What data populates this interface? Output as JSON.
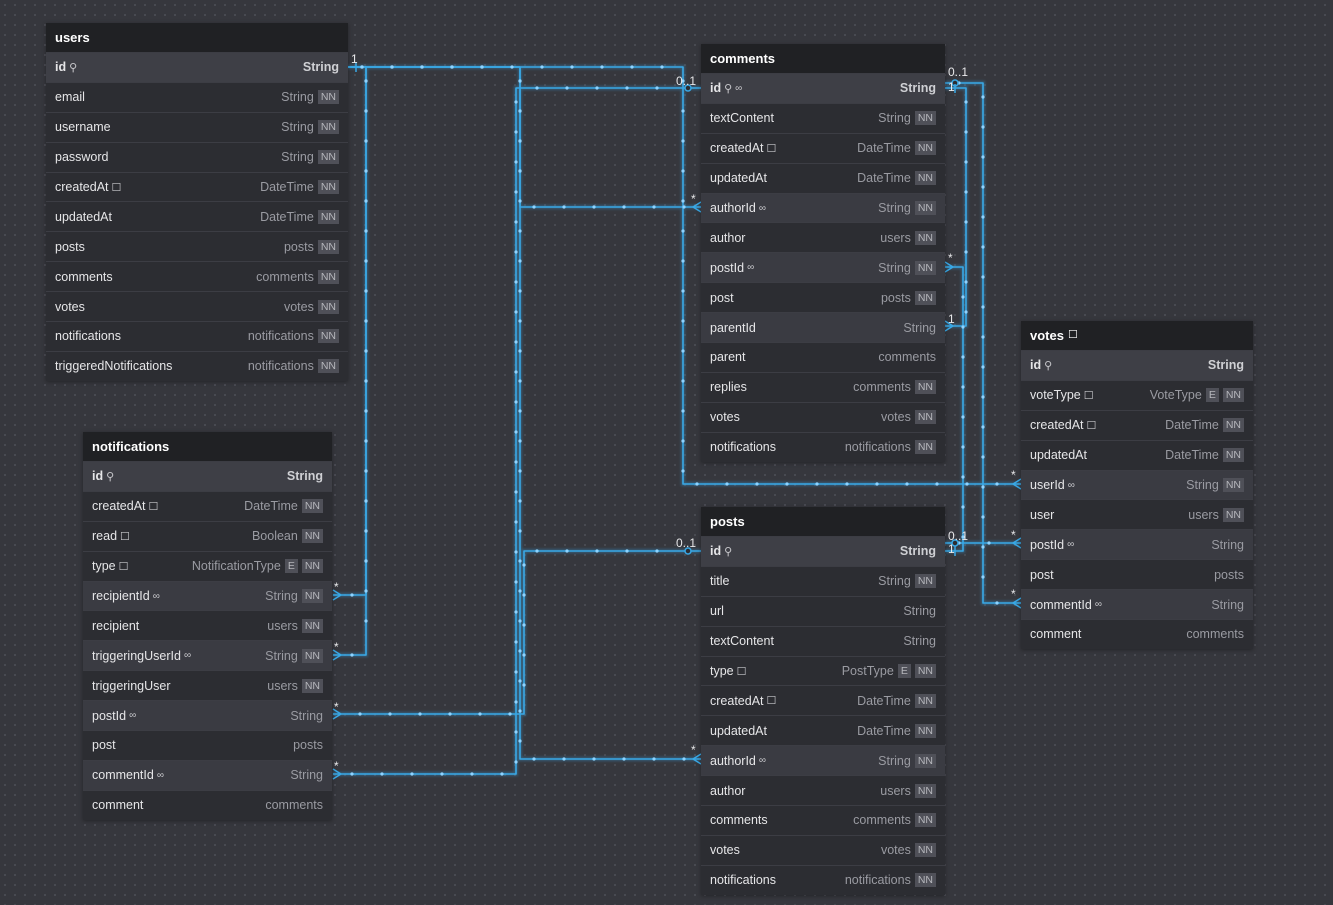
{
  "tables": [
    {
      "id": "users",
      "name": "users",
      "note": false,
      "fields": [
        {
          "name": "id",
          "type": "String",
          "pk": true,
          "icons": [
            "key"
          ]
        },
        {
          "name": "email",
          "type": "String",
          "nn": true
        },
        {
          "name": "username",
          "type": "String",
          "nn": true
        },
        {
          "name": "password",
          "type": "String",
          "nn": true
        },
        {
          "name": "createdAt",
          "type": "DateTime",
          "nn": true,
          "icons": [
            "note"
          ]
        },
        {
          "name": "updatedAt",
          "type": "DateTime",
          "nn": true
        },
        {
          "name": "posts",
          "type": "posts",
          "nn": true
        },
        {
          "name": "comments",
          "type": "comments",
          "nn": true
        },
        {
          "name": "votes",
          "type": "votes",
          "nn": true
        },
        {
          "name": "notifications",
          "type": "notifications",
          "nn": true
        },
        {
          "name": "triggeredNotifications",
          "type": "notifications",
          "nn": true
        }
      ]
    },
    {
      "id": "notifications",
      "name": "notifications",
      "note": false,
      "fields": [
        {
          "name": "id",
          "type": "String",
          "pk": true,
          "icons": [
            "key"
          ]
        },
        {
          "name": "createdAt",
          "type": "DateTime",
          "nn": true,
          "icons": [
            "note"
          ]
        },
        {
          "name": "read",
          "type": "Boolean",
          "nn": true,
          "icons": [
            "note"
          ]
        },
        {
          "name": "type",
          "type": "NotificationType",
          "enum": true,
          "nn": true,
          "icons": [
            "note"
          ]
        },
        {
          "name": "recipientId",
          "type": "String",
          "nn": true,
          "fk": true,
          "icons": [
            "link"
          ]
        },
        {
          "name": "recipient",
          "type": "users",
          "nn": true
        },
        {
          "name": "triggeringUserId",
          "type": "String",
          "nn": true,
          "fk": true,
          "icons": [
            "link"
          ]
        },
        {
          "name": "triggeringUser",
          "type": "users",
          "nn": true
        },
        {
          "name": "postId",
          "type": "String",
          "fk": true,
          "icons": [
            "link"
          ]
        },
        {
          "name": "post",
          "type": "posts"
        },
        {
          "name": "commentId",
          "type": "String",
          "fk": true,
          "icons": [
            "link"
          ]
        },
        {
          "name": "comment",
          "type": "comments"
        }
      ]
    },
    {
      "id": "comments",
      "name": "comments",
      "note": false,
      "fields": [
        {
          "name": "id",
          "type": "String",
          "pk": true,
          "icons": [
            "key",
            "link"
          ]
        },
        {
          "name": "textContent",
          "type": "String",
          "nn": true
        },
        {
          "name": "createdAt",
          "type": "DateTime",
          "nn": true,
          "icons": [
            "note"
          ]
        },
        {
          "name": "updatedAt",
          "type": "DateTime",
          "nn": true
        },
        {
          "name": "authorId",
          "type": "String",
          "nn": true,
          "fk": true,
          "icons": [
            "link"
          ]
        },
        {
          "name": "author",
          "type": "users",
          "nn": true
        },
        {
          "name": "postId",
          "type": "String",
          "nn": true,
          "fk": true,
          "icons": [
            "link"
          ]
        },
        {
          "name": "post",
          "type": "posts",
          "nn": true
        },
        {
          "name": "parentId",
          "type": "String",
          "fk": true
        },
        {
          "name": "parent",
          "type": "comments"
        },
        {
          "name": "replies",
          "type": "comments",
          "nn": true
        },
        {
          "name": "votes",
          "type": "votes",
          "nn": true
        },
        {
          "name": "notifications",
          "type": "notifications",
          "nn": true
        }
      ]
    },
    {
      "id": "posts",
      "name": "posts",
      "note": false,
      "fields": [
        {
          "name": "id",
          "type": "String",
          "pk": true,
          "icons": [
            "key"
          ]
        },
        {
          "name": "title",
          "type": "String",
          "nn": true
        },
        {
          "name": "url",
          "type": "String"
        },
        {
          "name": "textContent",
          "type": "String"
        },
        {
          "name": "type",
          "type": "PostType",
          "enum": true,
          "nn": true,
          "icons": [
            "note"
          ]
        },
        {
          "name": "createdAt",
          "type": "DateTime",
          "nn": true,
          "icons": [
            "note"
          ]
        },
        {
          "name": "updatedAt",
          "type": "DateTime",
          "nn": true
        },
        {
          "name": "authorId",
          "type": "String",
          "nn": true,
          "fk": true,
          "icons": [
            "link"
          ]
        },
        {
          "name": "author",
          "type": "users",
          "nn": true
        },
        {
          "name": "comments",
          "type": "comments",
          "nn": true
        },
        {
          "name": "votes",
          "type": "votes",
          "nn": true
        },
        {
          "name": "notifications",
          "type": "notifications",
          "nn": true
        }
      ]
    },
    {
      "id": "votes",
      "name": "votes",
      "note": true,
      "fields": [
        {
          "name": "id",
          "type": "String",
          "pk": true,
          "icons": [
            "key"
          ]
        },
        {
          "name": "voteType",
          "type": "VoteType",
          "enum": true,
          "nn": true,
          "icons": [
            "note"
          ]
        },
        {
          "name": "createdAt",
          "type": "DateTime",
          "nn": true,
          "icons": [
            "note"
          ]
        },
        {
          "name": "updatedAt",
          "type": "DateTime",
          "nn": true
        },
        {
          "name": "userId",
          "type": "String",
          "nn": true,
          "fk": true,
          "icons": [
            "link"
          ]
        },
        {
          "name": "user",
          "type": "users",
          "nn": true
        },
        {
          "name": "postId",
          "type": "String",
          "fk": true,
          "icons": [
            "link"
          ]
        },
        {
          "name": "post",
          "type": "posts"
        },
        {
          "name": "commentId",
          "type": "String",
          "fk": true,
          "icons": [
            "link"
          ]
        },
        {
          "name": "comment",
          "type": "comments"
        }
      ]
    }
  ],
  "badges": {
    "not_null": "NN",
    "enum": "E"
  },
  "cardinality_labels": [
    "1",
    "0..1",
    "*",
    "0..1",
    "1",
    "*",
    "1",
    "*",
    "*",
    "0..1",
    "1",
    "*",
    "*",
    "*",
    "*",
    "*"
  ],
  "colors": {
    "edge": "#39a8e6",
    "header": "#202124",
    "table": "#2c2d32",
    "canvas": "#36373d"
  }
}
